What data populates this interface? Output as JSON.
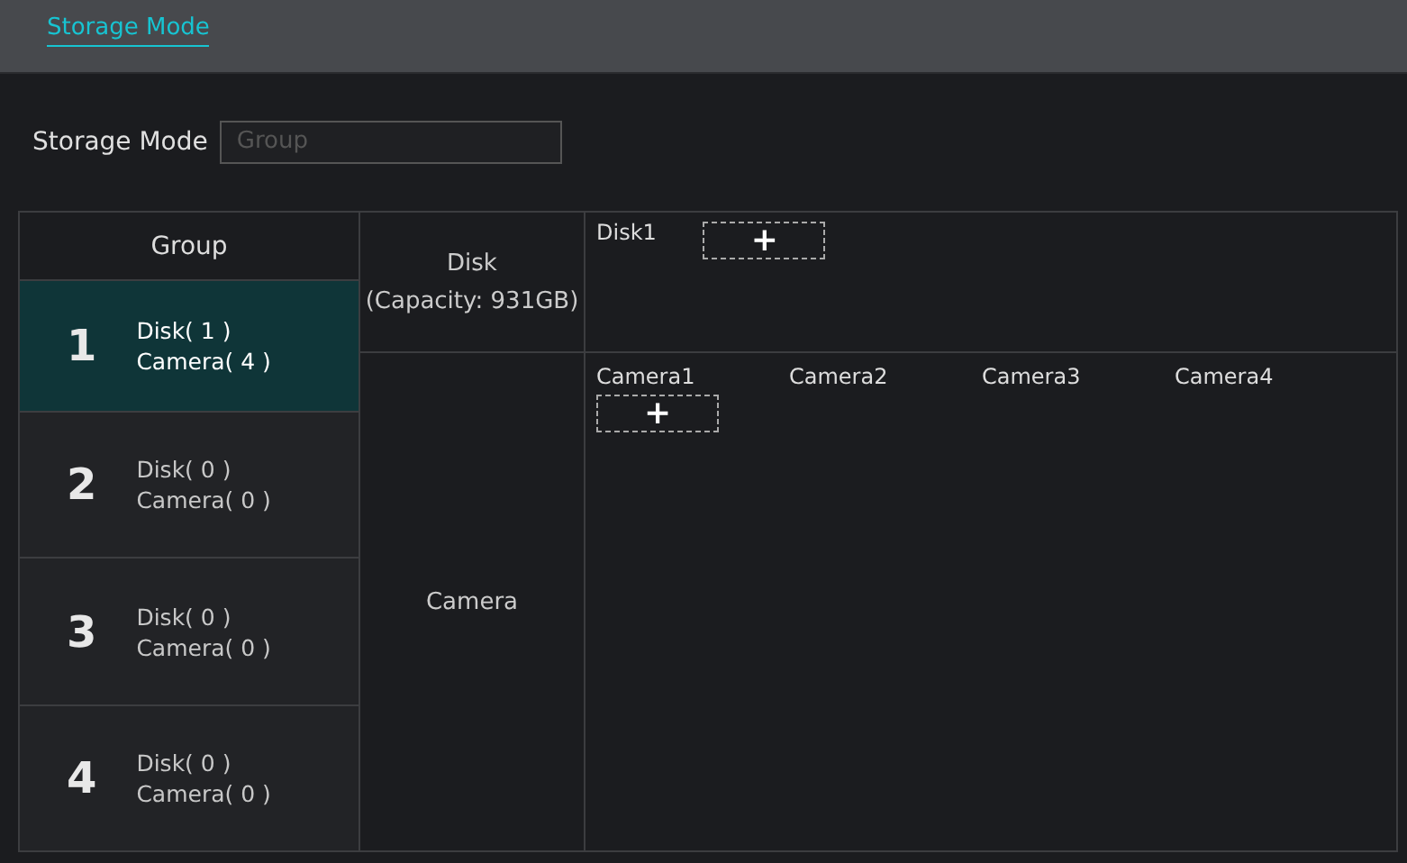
{
  "tabs": [
    {
      "label": "Storage Mode",
      "selected": true
    }
  ],
  "storage_mode": {
    "label": "Storage Mode",
    "value": "Group",
    "disabled": true
  },
  "groups_header": "Group",
  "groups": [
    {
      "number": "1",
      "disk": "Disk( 1 )",
      "camera": "Camera( 4 )",
      "selected": true
    },
    {
      "number": "2",
      "disk": "Disk( 0 )",
      "camera": "Camera( 0 )",
      "selected": false
    },
    {
      "number": "3",
      "disk": "Disk( 0 )",
      "camera": "Camera( 0 )",
      "selected": false
    },
    {
      "number": "4",
      "disk": "Disk( 0 )",
      "camera": "Camera( 0 )",
      "selected": false
    }
  ],
  "disk_section": {
    "label": "Disk",
    "capacity": "(Capacity: 931GB)",
    "items": [
      "Disk1"
    ],
    "add_button": "+"
  },
  "camera_section": {
    "label": "Camera",
    "items": [
      "Camera1",
      "Camera2",
      "Camera3",
      "Camera4"
    ],
    "add_button": "+"
  }
}
